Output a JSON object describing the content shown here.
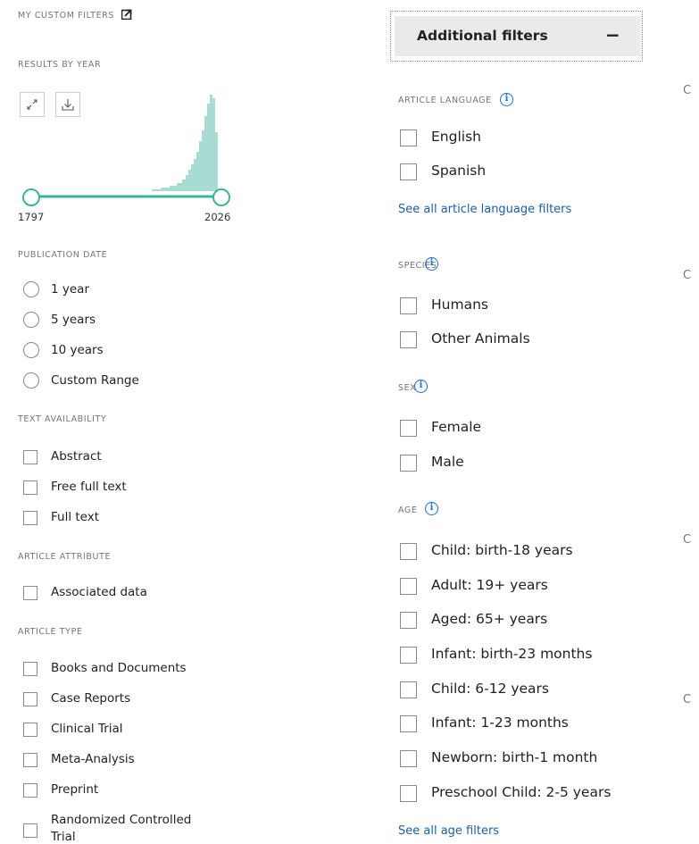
{
  "left": {
    "my_filters": "MY CUSTOM FILTERS",
    "results_by_year": "RESULTS BY YEAR",
    "timeline": {
      "start_year": "1797",
      "end_year": "2026",
      "accent": "#39b49a",
      "bar_color": "#a8dcd2"
    },
    "publication_date": {
      "heading": "PUBLICATION DATE",
      "options": [
        "1 year",
        "5 years",
        "10 years",
        "Custom Range"
      ]
    },
    "text_availability": {
      "heading": "TEXT AVAILABILITY",
      "options": [
        "Abstract",
        "Free full text",
        "Full text"
      ]
    },
    "article_attribute": {
      "heading": "ARTICLE ATTRIBUTE",
      "options": [
        "Associated data"
      ]
    },
    "article_type": {
      "heading": "ARTICLE TYPE",
      "options": [
        "Books and Documents",
        "Case Reports",
        "Clinical Trial",
        "Meta-Analysis",
        "Preprint",
        "Randomized Controlled",
        "Trial"
      ]
    }
  },
  "additional": {
    "button_label": "Additional filters",
    "toggle_symbol": "−",
    "language": {
      "heading": "ARTICLE LANGUAGE",
      "options": [
        "English",
        "Spanish"
      ],
      "see_all": "See all article language filters"
    },
    "species": {
      "heading": "SPECIES",
      "options": [
        "Humans",
        "Other Animals"
      ]
    },
    "sex": {
      "heading": "SEX",
      "options": [
        "Female",
        "Male"
      ]
    },
    "age": {
      "heading": "AGE",
      "options": [
        "Child: birth-18 years",
        "Adult: 19+ years",
        "Aged: 65+ years",
        "Infant: birth-23 months",
        "Child: 6-12 years",
        "Infant: 1-23 months",
        "Newborn: birth-1 month",
        "Preschool Child: 2-5 years"
      ],
      "see_all": "See all age filters"
    },
    "info_glyph": "i"
  },
  "right_clip_glyph": "C",
  "colors": {
    "link": "#1a5fa3",
    "info": "#1d6fd6"
  }
}
